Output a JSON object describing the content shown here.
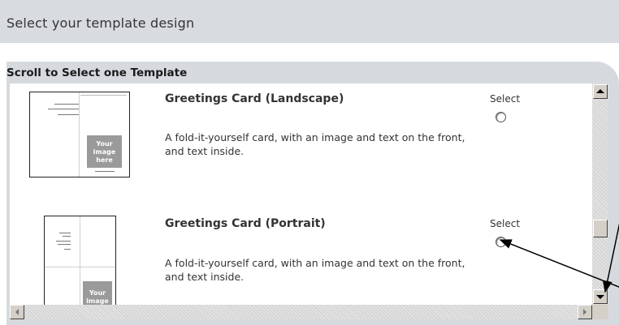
{
  "header": {
    "title": "Select your template design"
  },
  "panel": {
    "title": "Scroll to Select one Template"
  },
  "templates": [
    {
      "name": "Greetings Card (Landscape)",
      "description": "A fold-it-yourself card, with an image and text on the front, and text inside.",
      "select_label": "Select",
      "thumbnail_image_text": "Your image here"
    },
    {
      "name": "Greetings Card (Portrait)",
      "description": "A fold-it-yourself card, with an image and text on the front, and text inside.",
      "select_label": "Select",
      "thumbnail_image_text": "Your image"
    }
  ],
  "colors": {
    "header_bg": "#d8dce0",
    "panel_bg": "#d6dade",
    "image_placeholder": "#9a9a9a"
  }
}
